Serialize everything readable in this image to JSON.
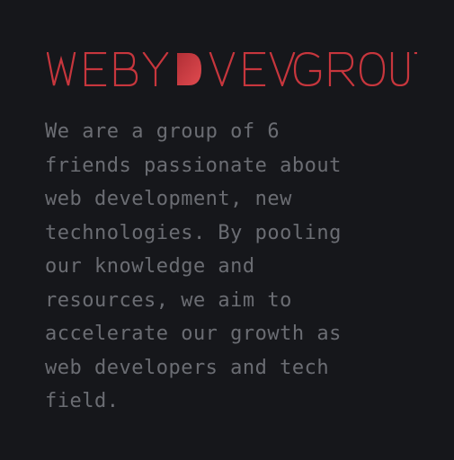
{
  "brand": {
    "name": "WEBYDEVGROUP",
    "color": "#c7363d"
  },
  "about": {
    "text": "We are a group of 6\nfriends passionate about\nweb development, new\ntechnologies. By pooling\nour knowledge and\nresources, we aim to\naccelerate our growth as\nweb developers and tech\nfield."
  },
  "theme": {
    "background": "#16171b",
    "text_color": "#6b6d73"
  }
}
